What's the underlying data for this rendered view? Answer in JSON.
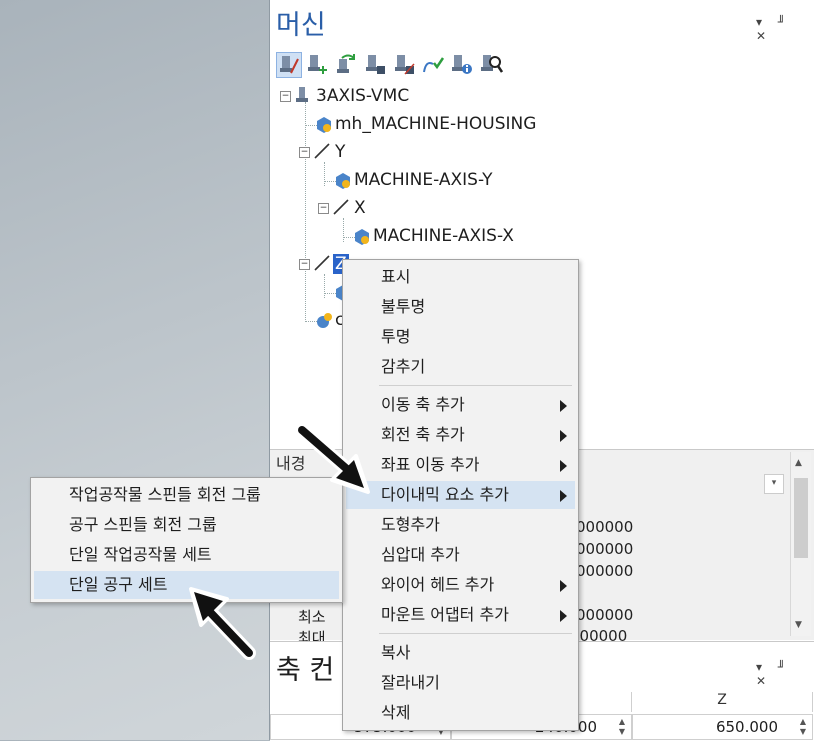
{
  "machine_panel": {
    "title": "머신",
    "window_controls": "▾ ╜ ✕",
    "tree": {
      "root": "3AXIS-VMC",
      "housing": "mh_MACHINE-HOUSING",
      "axis_y": "Y",
      "axis_y_child": "MACHINE-AXIS-Y",
      "axis_x": "X",
      "axis_x_child": "MACHINE-AXIS-X",
      "axis_z": "Z",
      "partial_node": "c"
    }
  },
  "properties": {
    "header": "내경",
    "values": [
      "000000",
      "000000",
      "000000",
      "000000",
      "000000"
    ],
    "labels": [
      "최소",
      "최대"
    ]
  },
  "axis_panel": {
    "title": "축 컨",
    "columns": [
      "",
      "",
      "Z"
    ],
    "values": [
      "575.000",
      "240.000",
      "650.000"
    ]
  },
  "context_menu": {
    "items": [
      {
        "label": "표시"
      },
      {
        "label": "불투명"
      },
      {
        "label": "투명"
      },
      {
        "label": "감추기"
      },
      {
        "label": "이동 축 추가"
      },
      {
        "label": "회전 축 추가"
      },
      {
        "label": "좌표 이동 추가"
      },
      {
        "label": "다이내믹 요소 추가"
      },
      {
        "label": "도형추가"
      },
      {
        "label": "심압대 추가"
      },
      {
        "label": "와이어 헤드 추가"
      },
      {
        "label": "마운트 어댑터 추가"
      },
      {
        "label": "복사"
      },
      {
        "label": "잘라내기"
      },
      {
        "label": "삭제"
      }
    ]
  },
  "submenu": {
    "items": [
      {
        "label": "작업공작물 스핀들 회전 그룹"
      },
      {
        "label": "공구 스핀들 회전 그룹"
      },
      {
        "label": "단일 작업공작물 세트"
      },
      {
        "label": "단일 공구 세트"
      }
    ]
  },
  "colors": {
    "title_blue": "#2a5ea8",
    "highlight": "#d5e3f2",
    "selection": "#2a63c9"
  }
}
